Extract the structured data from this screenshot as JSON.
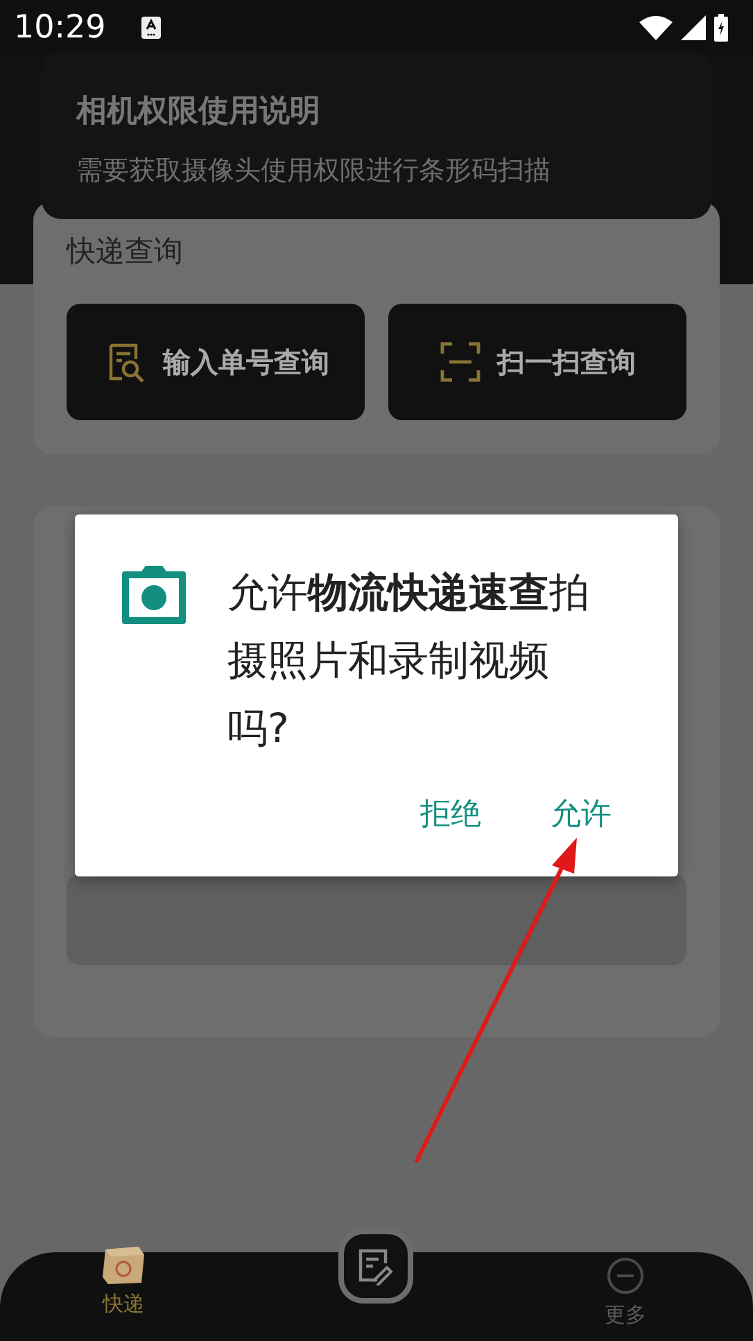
{
  "status_bar": {
    "time": "10:29"
  },
  "permission_banner": {
    "title": "相机权限使用说明",
    "description": "需要获取摄像头使用权限进行条形码扫描"
  },
  "express_card": {
    "title": "快递查询",
    "buttons": [
      {
        "label": "输入单号查询",
        "kind": "search"
      },
      {
        "label": "扫一扫查询",
        "kind": "scan"
      }
    ]
  },
  "dialog": {
    "message": "允许**物流快递速查**拍摄照片和录制视频吗?",
    "buttons": [
      "拒绝",
      "允许"
    ]
  },
  "bottom_nav": {
    "items": [
      {
        "label": "快递",
        "kind": "box",
        "selected": true
      },
      {
        "label": "更多",
        "kind": "more",
        "selected": false
      }
    ]
  }
}
